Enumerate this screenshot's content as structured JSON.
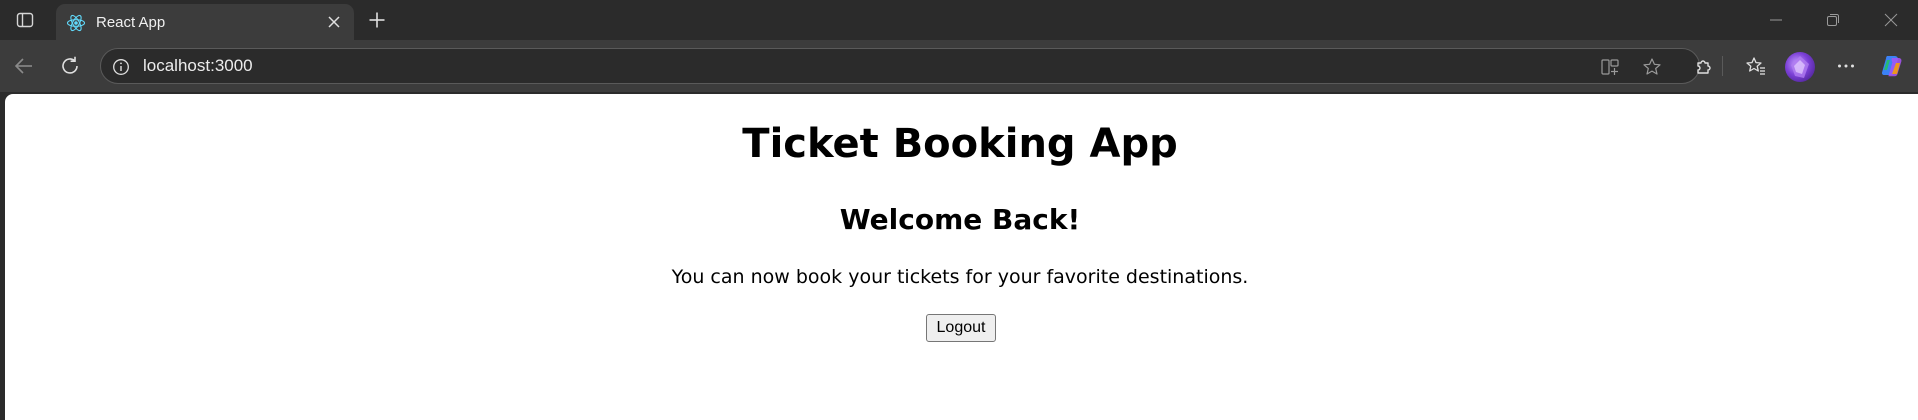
{
  "browser": {
    "tab": {
      "title": "React App",
      "favicon": "react-logo-icon"
    },
    "toolbar": {
      "url": "localhost:3000",
      "icons": [
        "back-arrow-icon",
        "reload-icon",
        "site-info-icon",
        "split-screen-icon",
        "favorite-star-icon",
        "extensions-icon",
        "favorites-icon",
        "profile-avatar",
        "more-icon",
        "copilot-icon"
      ]
    },
    "window_controls": [
      "minimize-icon",
      "restore-icon",
      "close-icon"
    ],
    "colors": {
      "chrome_dark": "#2b2b2b",
      "toolbar": "#3c3c3c",
      "accent_react": "#61dafb"
    }
  },
  "page": {
    "heading": "Ticket Booking App",
    "subheading": "Welcome Back!",
    "message": "You can now book your tickets for your favorite destinations.",
    "logout_label": "Logout"
  }
}
